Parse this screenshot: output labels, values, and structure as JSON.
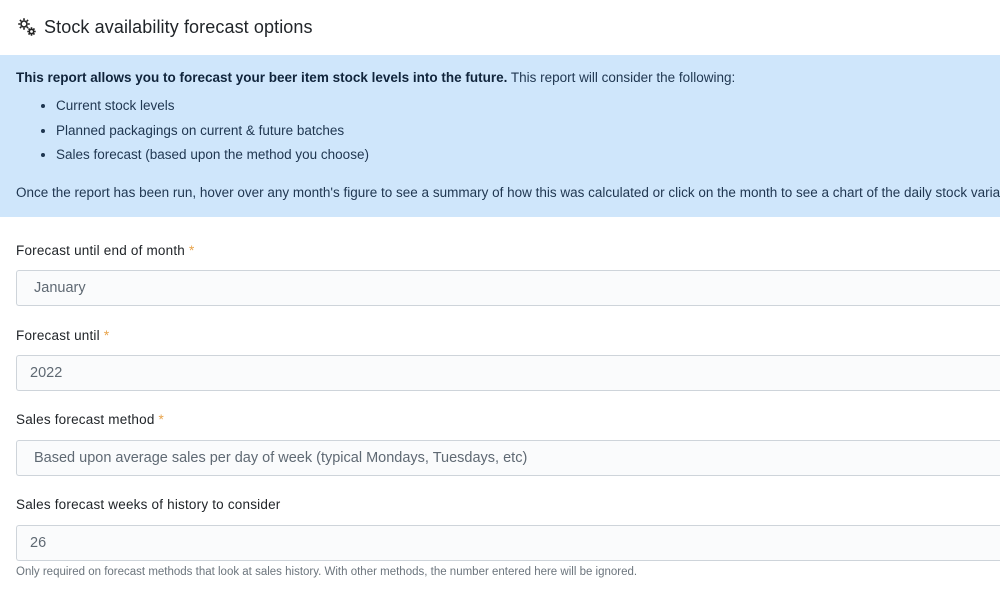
{
  "header": {
    "title": "Stock availability forecast options",
    "icon": "gears-icon"
  },
  "info": {
    "intro_bold": "This report allows you to forecast your beer item stock levels into the future.",
    "intro_rest": " This report will consider the following:",
    "items": [
      "Current stock levels",
      "Planned packagings on current & future batches",
      "Sales forecast (based upon the method you choose)"
    ],
    "outro": "Once the report has been run, hover over any month's figure to see a summary of how this was calculated or click on the month to see a chart of the daily stock variation."
  },
  "form": {
    "month": {
      "label": "Forecast until end of month",
      "required": "*",
      "value": "January"
    },
    "year": {
      "label": "Forecast until",
      "required": "*",
      "value": "2022"
    },
    "method": {
      "label": "Sales forecast method",
      "required": "*",
      "value": "Based upon average sales per day of week (typical Mondays, Tuesdays, etc)"
    },
    "weeks": {
      "label": "Sales forecast weeks of history to consider",
      "value": "26",
      "help": "Only required on forecast methods that look at sales history. With other methods, the number entered here will be ignored."
    }
  },
  "colors": {
    "info_bg": "#cfe6fb",
    "required": "#e8a34a"
  }
}
